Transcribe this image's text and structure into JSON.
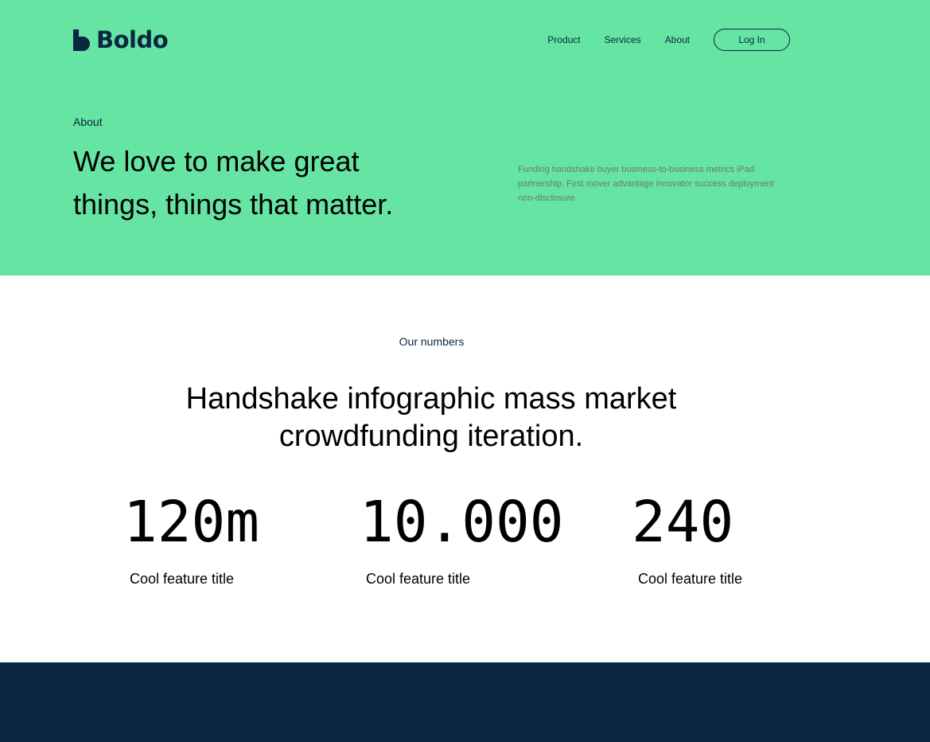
{
  "brand": {
    "name": "Boldo",
    "color": "#0a2640"
  },
  "colors": {
    "hero_bg": "#65e4a3",
    "dark_navy": "#0a2640"
  },
  "nav": {
    "links": [
      "Product",
      "Services",
      "About"
    ],
    "login_label": "Log In"
  },
  "hero": {
    "eyebrow": "About",
    "title_line1": "We love to make great",
    "title_line2": "things, things that matter.",
    "description": "Funding handshake buyer business-to-business metrics iPad partnership. First mover advantage innovator success deployment non-disclosure."
  },
  "numbers": {
    "eyebrow": "Our numbers",
    "title_line1": "Handshake infographic mass market",
    "title_line2": "crowdfunding iteration.",
    "stats": [
      {
        "value": "120m",
        "label": "Cool feature title"
      },
      {
        "value": "10.000",
        "label": "Cool feature title"
      },
      {
        "value": "240",
        "label": "Cool feature title"
      }
    ]
  }
}
